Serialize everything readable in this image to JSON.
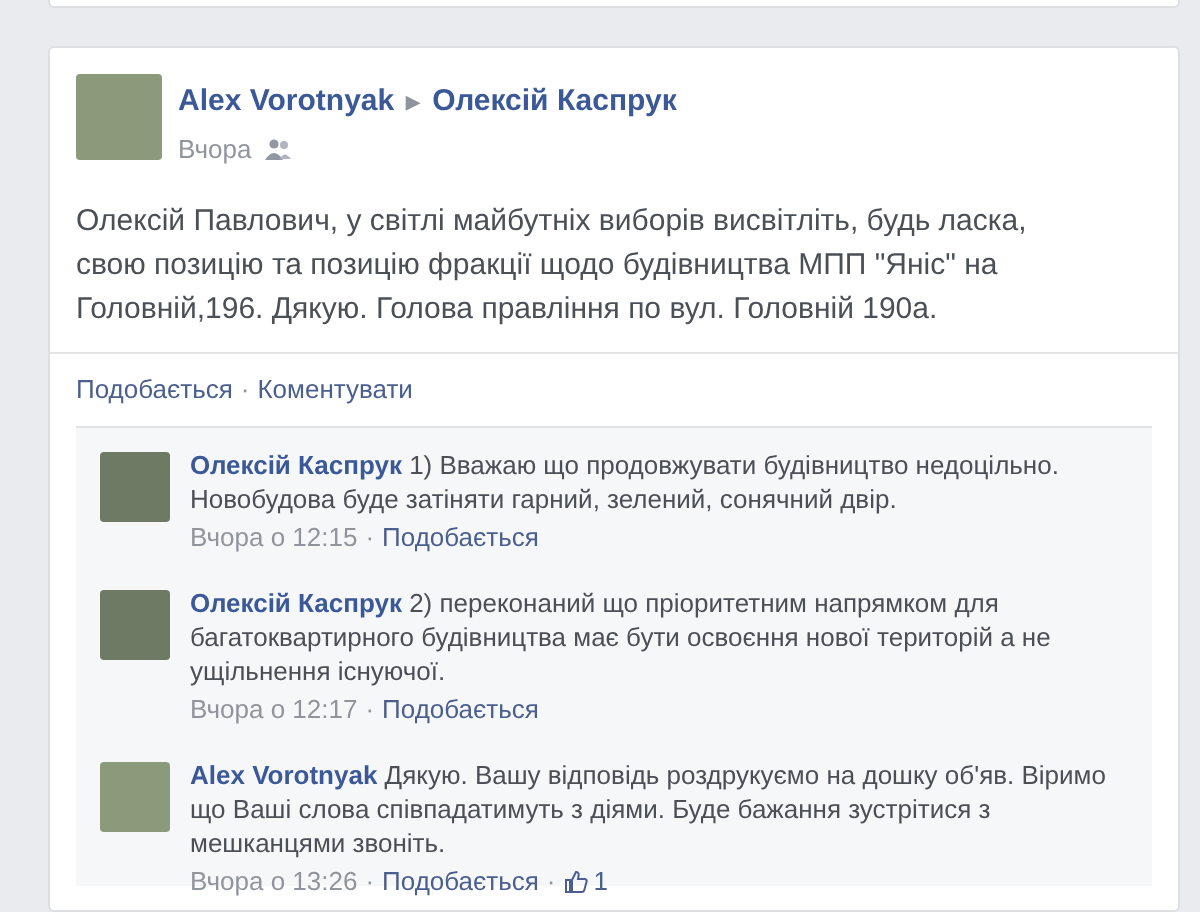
{
  "post": {
    "author": "Alex Vorotnyak",
    "separator": "▶",
    "target": "Олексій Каспрук",
    "time": "Вчора",
    "text": "Олексій Павлович, у світлі майбутніх виборів висвітліть, будь ласка, свою позицію та позицію фракції щодо будівництва МПП \"Яніс\" на Головній,196. Дякую. Голова правління по вул. Головній 190а.",
    "actions": [
      "Подобається",
      "Коментувати"
    ],
    "action_separator": "·"
  },
  "comments": [
    {
      "author": "Олексій Каспрук",
      "text": "1) Вважаю що продовжувати будівництво недоцільно. Новобудова буде затіняти гарний, зелений, сонячний двір.",
      "time": "Вчора о 12:15",
      "separator": "·",
      "like": "Подобається"
    },
    {
      "author": "Олексій Каспрук",
      "text": "2) переконаний що пріоритетним напрямком для багатоквартирного будівництва має бути освоєння нової територій а не ущільнення існуючої.",
      "time": "Вчора о 12:17",
      "separator": "·",
      "like": "Подобається"
    },
    {
      "author": "Alex Vorotnyak",
      "text": "Дякую. Вашу відповідь роздрукуємо на дошку об'яв. Віримо що Ваші слова співпадатимуть з діями. Буде бажання зустрітися з мешканцями звоніть.",
      "time": "Вчора о 13:26",
      "separator": "·",
      "like": "Подобається",
      "likes_separator": "·",
      "likes": "1"
    }
  ]
}
